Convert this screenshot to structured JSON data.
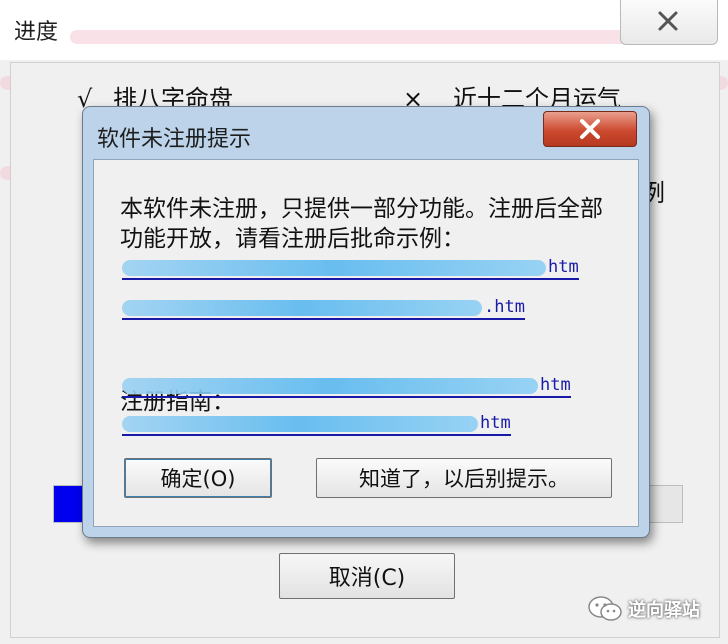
{
  "outer_window": {
    "title": "进度",
    "tasks": [
      {
        "mark": "√",
        "label": "排八字命盘"
      },
      {
        "mark": "×",
        "label": "近十二个月运气"
      }
    ],
    "hidden_glyph": "例",
    "progress_percent": 0.09,
    "cancel_label": "取消(C)"
  },
  "dialog": {
    "title": "软件未注册提示",
    "message": "本软件未注册，只提供一部分功能。注册后全部功能开放，请看注册后批命示例：",
    "example_links": [
      {
        "suffix": "htm"
      },
      {
        "suffix": ".htm"
      }
    ],
    "guide_label": "注册指南：",
    "guide_links": [
      {
        "suffix": "htm"
      },
      {
        "suffix": "htm"
      }
    ],
    "ok_label": "确定(O)",
    "dismiss_label": "知道了，以后别提示。"
  },
  "watermark": {
    "text": "逆向驿站",
    "icon": "wechat-icon"
  },
  "colors": {
    "progress_fill": "#0000ee",
    "link": "#1a1aa8",
    "dialog_frame": "#bcd3ea",
    "close_red": "#cc4a30"
  }
}
